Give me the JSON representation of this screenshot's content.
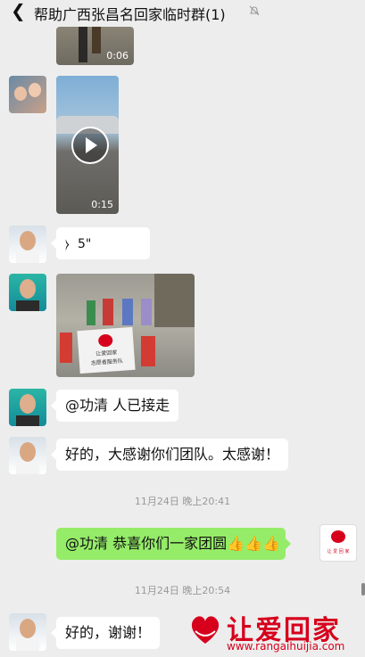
{
  "header": {
    "back_icon": "chevron-left-icon",
    "title": "帮助广西张昌名回家临时群(1)",
    "mute_icon": "bell-slash-icon"
  },
  "messages": [
    {
      "type": "video",
      "duration": "0:06"
    },
    {
      "type": "video",
      "duration": "0:15"
    },
    {
      "type": "voice",
      "duration": "5\""
    },
    {
      "type": "image",
      "banner_text_line1": "让爱回家",
      "banner_text_line2": "志愿者服务队"
    },
    {
      "type": "text",
      "text": "@功清  人已接走"
    },
    {
      "type": "text",
      "text": "好的，大感谢你们团队。太感谢！"
    },
    {
      "type": "time",
      "text": "11月24日 晚上20:41"
    },
    {
      "type": "text_self",
      "text": "@功清  恭喜你们一家团圆",
      "emoji": "👍👍👍"
    },
    {
      "type": "time",
      "text": "11月24日 晚上20:54"
    },
    {
      "type": "text",
      "text": "好的，谢谢！"
    }
  ],
  "self_avatar_text": "让 爱 回 家",
  "watermark": {
    "cn": "让爱回家",
    "url": "www.rangaihuijia.com"
  },
  "colors": {
    "background": "#ededed",
    "self_bubble": "#95ec69",
    "brand_red": "#d6001c"
  }
}
